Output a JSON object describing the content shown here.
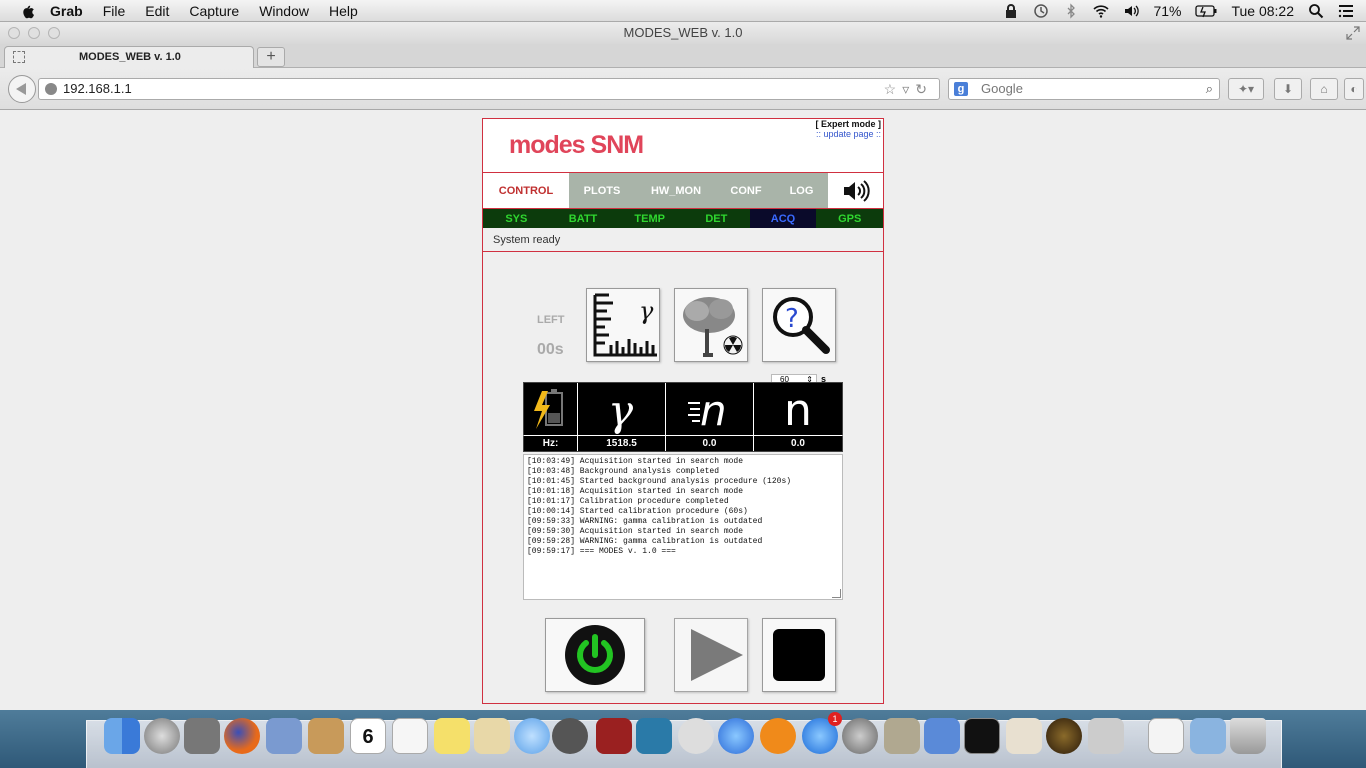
{
  "menubar": {
    "app_name": "Grab",
    "items": [
      "File",
      "Edit",
      "Capture",
      "Window",
      "Help"
    ],
    "battery": "71%",
    "clock": "Tue 08:22"
  },
  "browser": {
    "window_title": "MODES_WEB v. 1.0",
    "tab_title": "MODES_WEB v. 1.0",
    "new_tab": "+",
    "url": "192.168.1.1",
    "search_placeholder": "Google"
  },
  "app": {
    "logo_text": "modes SNM",
    "expert_mode": "[ Expert mode ]",
    "update_page": ":: update page ::",
    "tabs": [
      {
        "label": "CONTROL",
        "active": true
      },
      {
        "label": "PLOTS",
        "active": false
      },
      {
        "label": "HW_MON",
        "active": false
      },
      {
        "label": "CONF",
        "active": false
      },
      {
        "label": "LOG",
        "active": false
      }
    ],
    "subtabs": [
      {
        "label": "SYS",
        "active": false
      },
      {
        "label": "BATT",
        "active": false
      },
      {
        "label": "TEMP",
        "active": false
      },
      {
        "label": "DET",
        "active": false
      },
      {
        "label": "ACQ",
        "active": true
      },
      {
        "label": "GPS",
        "active": false
      }
    ],
    "status": "System ready",
    "left_label": "LEFT",
    "time_left": "00s",
    "duration_value": "60",
    "duration_unit": "s",
    "hz_label": "Hz:",
    "rates": {
      "gamma": "1518.5",
      "fast_neutron": "0.0",
      "neutron": "0.0"
    },
    "log_lines": [
      "[10:03:49] Acquisition started in search mode",
      "[10:03:48] Background analysis completed",
      "[10:01:45] Started background analysis procedure (120s)",
      "[10:01:18] Acquisition started in search mode",
      "[10:01:17] Calibration procedure completed",
      "[10:00:14] Started calibration procedure (60s)",
      "[09:59:33] WARNING: gamma calibration is outdated",
      "[09:59:30] Acquisition started in search mode",
      "[09:59:28] WARNING: gamma calibration is outdated",
      "[09:59:17] === MODES v. 1.0 ==="
    ],
    "colors": {
      "accent": "#d03040",
      "power_green": "#22c422",
      "subtab_green": "#2fd62f",
      "subtab_active_blue": "#3a6aff"
    }
  },
  "dock": {
    "calendar_day": "6",
    "appstore_badge": "1"
  }
}
